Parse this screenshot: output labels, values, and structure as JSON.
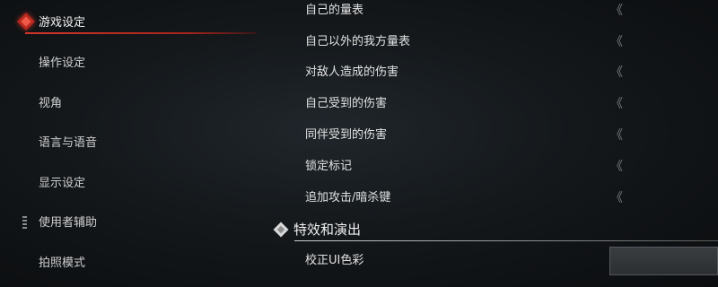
{
  "sidebar": {
    "items": [
      {
        "label": "游戏设定",
        "active": true
      },
      {
        "label": "操作设定"
      },
      {
        "label": "视角"
      },
      {
        "label": "语言与语音"
      },
      {
        "label": "显示设定"
      },
      {
        "label": "使用者辅助"
      },
      {
        "label": "拍照模式"
      }
    ],
    "accent_color": "#c62e24"
  },
  "settings": {
    "rows": [
      {
        "label": "自己的量表",
        "arrow": "《"
      },
      {
        "label": "自己以外的我方量表",
        "arrow": "《"
      },
      {
        "label": "对敌人造成的伤害",
        "arrow": "《"
      },
      {
        "label": "自己受到的伤害",
        "arrow": "《"
      },
      {
        "label": "同伴受到的伤害",
        "arrow": "《"
      },
      {
        "label": "锁定标记",
        "arrow": "《"
      },
      {
        "label": "追加攻击/暗杀键",
        "arrow": "《"
      }
    ],
    "section": {
      "title": "特效和演出",
      "rows": [
        {
          "label": "校正UI色彩"
        }
      ]
    }
  }
}
